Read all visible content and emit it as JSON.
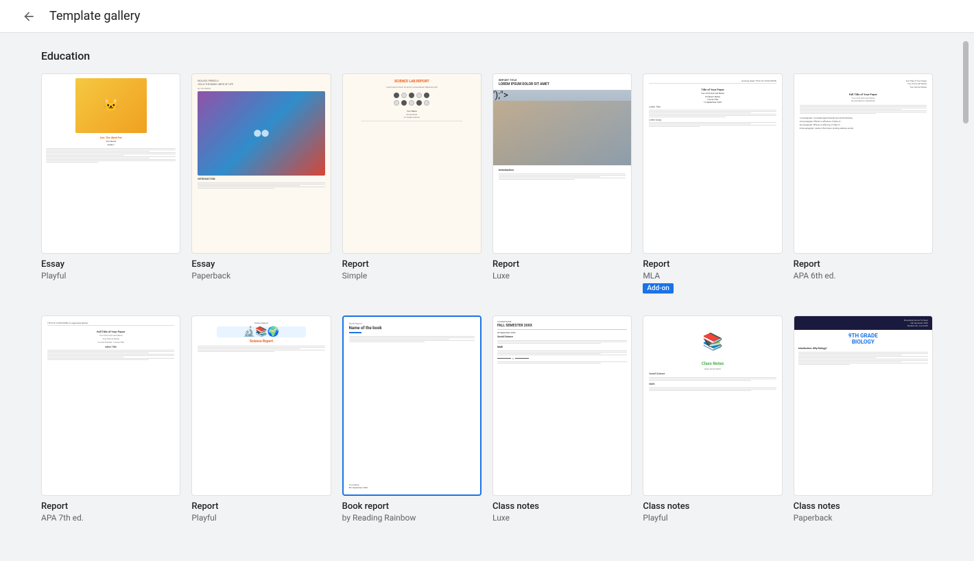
{
  "header": {
    "back_label": "←",
    "title": "Template gallery"
  },
  "sections": [
    {
      "id": "education",
      "title": "Education",
      "templates": [
        {
          "id": "essay-playful",
          "name": "Essay",
          "subname": "Playful",
          "badge": null,
          "selected": false
        },
        {
          "id": "essay-paperback",
          "name": "Essay",
          "subname": "Paperback",
          "badge": null,
          "selected": false
        },
        {
          "id": "report-simple",
          "name": "Report",
          "subname": "Simple",
          "badge": null,
          "selected": false
        },
        {
          "id": "report-luxe",
          "name": "Report",
          "subname": "Luxe",
          "badge": null,
          "selected": false
        },
        {
          "id": "report-mla",
          "name": "Report",
          "subname": "MLA",
          "badge": "Add-on",
          "selected": false
        },
        {
          "id": "report-apa6",
          "name": "Report",
          "subname": "APA 6th ed.",
          "badge": null,
          "selected": false
        },
        {
          "id": "report-apa7",
          "name": "Report",
          "subname": "APA 7th ed.",
          "badge": null,
          "selected": false
        },
        {
          "id": "report-playful",
          "name": "Report",
          "subname": "Playful",
          "badge": null,
          "selected": false
        },
        {
          "id": "bookreport-rainbow",
          "name": "Book report",
          "subname": "by Reading Rainbow",
          "badge": null,
          "selected": true
        },
        {
          "id": "classnotes-luxe",
          "name": "Class notes",
          "subname": "Luxe",
          "badge": null,
          "selected": false
        },
        {
          "id": "classnotes-playful",
          "name": "Class notes",
          "subname": "Playful",
          "badge": null,
          "selected": false
        },
        {
          "id": "classnotes-paperback",
          "name": "Class notes",
          "subname": "Paperback",
          "badge": null,
          "selected": false
        }
      ]
    }
  ],
  "addon_badge_label": "Add-on"
}
